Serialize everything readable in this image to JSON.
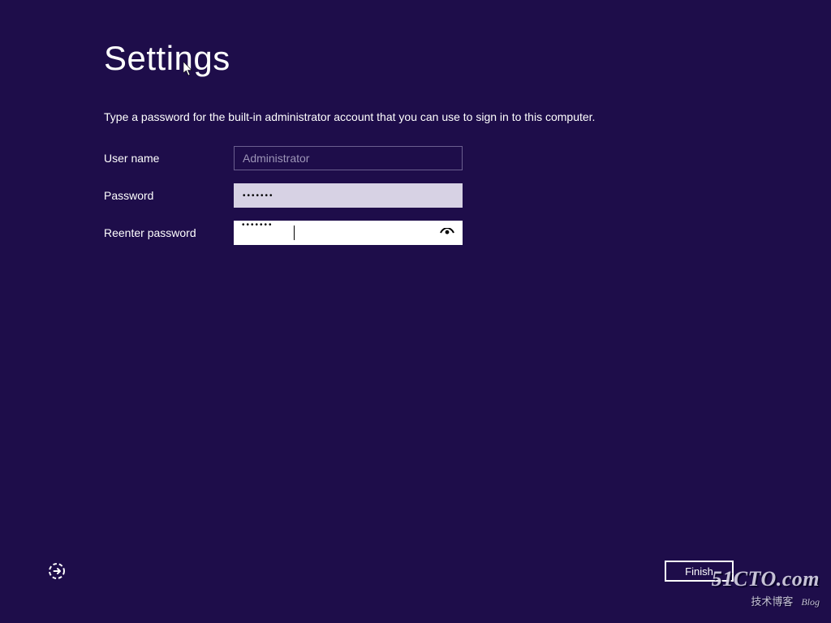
{
  "title": "Settings",
  "instruction": "Type a password for the built-in administrator account that you can use to sign in to this computer.",
  "form": {
    "username_label": "User name",
    "username_value": "Administrator",
    "password_label": "Password",
    "password_value": "•••••••",
    "reenter_label": "Reenter password",
    "reenter_value": "•••••••"
  },
  "finish_label": "Finish",
  "watermark": {
    "main": "51CTO.com",
    "sub": "技术博客",
    "blog": "Blog"
  },
  "colors": {
    "background": "#1e0d4a",
    "text": "#ffffff",
    "inactive_field_text": "#9d95b7",
    "inactive_field_border": "#6b5f8f",
    "filled_field_bg": "#d7d2e4",
    "active_field_bg": "#ffffff"
  }
}
